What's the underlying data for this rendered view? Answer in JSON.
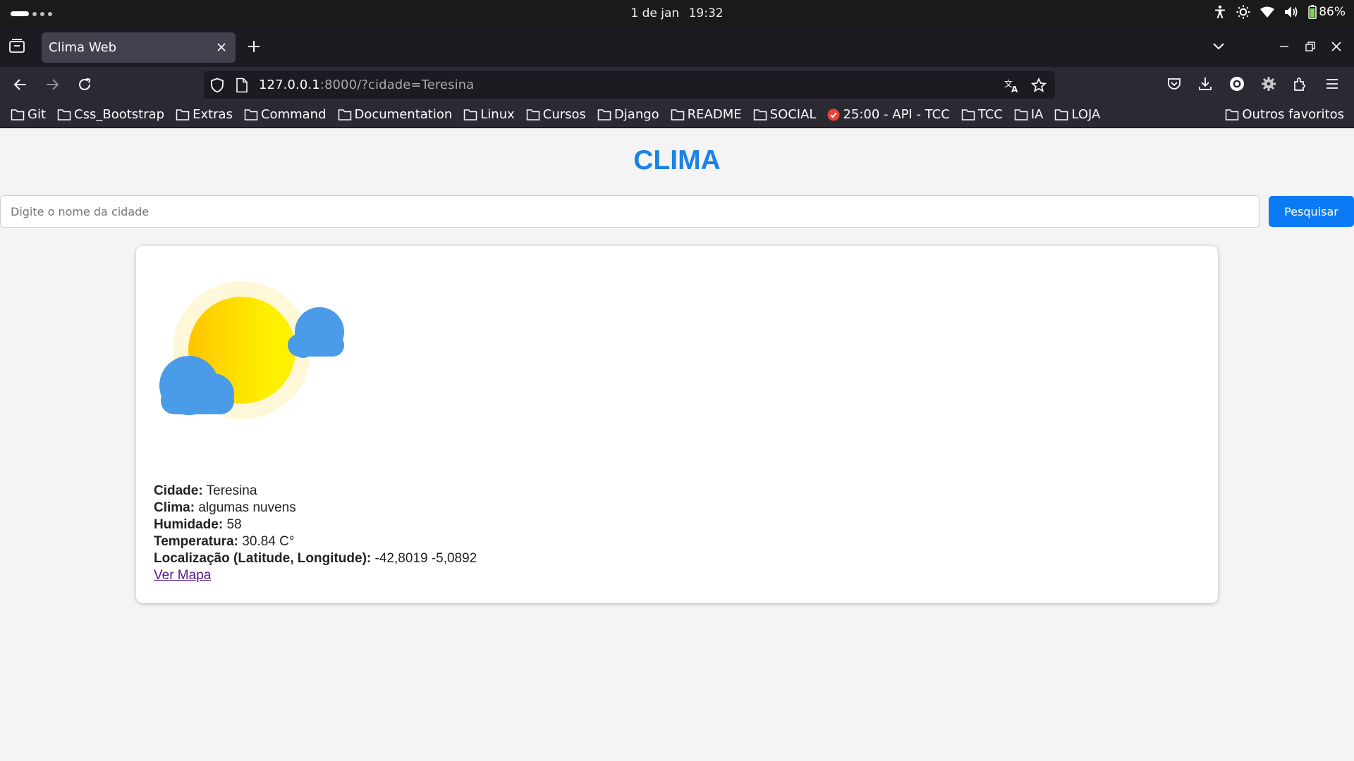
{
  "system": {
    "date": "1 de jan",
    "time": "19:32",
    "battery": "86%"
  },
  "browser": {
    "tab_title": "Clima Web",
    "url_host": "127.0.0.1",
    "url_rest": ":8000/?cidade=Teresina"
  },
  "bookmarks": [
    {
      "label": "Git",
      "icon": "folder-icon"
    },
    {
      "label": "Css_Bootstrap",
      "icon": "folder-icon"
    },
    {
      "label": "Extras",
      "icon": "folder-icon"
    },
    {
      "label": "Command",
      "icon": "folder-icon"
    },
    {
      "label": "Documentation",
      "icon": "folder-icon"
    },
    {
      "label": "Linux",
      "icon": "folder-icon"
    },
    {
      "label": "Cursos",
      "icon": "folder-icon"
    },
    {
      "label": "Django",
      "icon": "folder-icon"
    },
    {
      "label": "README",
      "icon": "folder-icon"
    },
    {
      "label": "SOCIAL",
      "icon": "folder-icon"
    },
    {
      "label": "25:00 - API - TCC",
      "icon": "check-circle-icon"
    },
    {
      "label": "TCC",
      "icon": "folder-icon"
    },
    {
      "label": "IA",
      "icon": "folder-icon"
    },
    {
      "label": "LOJA",
      "icon": "folder-icon"
    }
  ],
  "other_bookmarks": "Outros favoritos",
  "page": {
    "title": "CLIMA",
    "search_placeholder": "Digite o nome da cidade",
    "search_button": "Pesquisar",
    "weather_icon": "sun-with-clouds-icon",
    "fields": {
      "city_label": "Cidade:",
      "city_value": "Teresina",
      "weather_label": "Clima:",
      "weather_value": "algumas nuvens",
      "humidity_label": "Humidade:",
      "humidity_value": "58",
      "temperature_label": "Temperatura:",
      "temperature_value": "30.84 C°",
      "location_label": "Localização (Latitude, Longitude):",
      "location_value": "-42,8019 -5,0892"
    },
    "map_link": "Ver Mapa"
  },
  "colors": {
    "title": "#1a82e8",
    "button": "#0a7bf5",
    "sun": "#ffd400",
    "cloud": "#4a9be8"
  }
}
